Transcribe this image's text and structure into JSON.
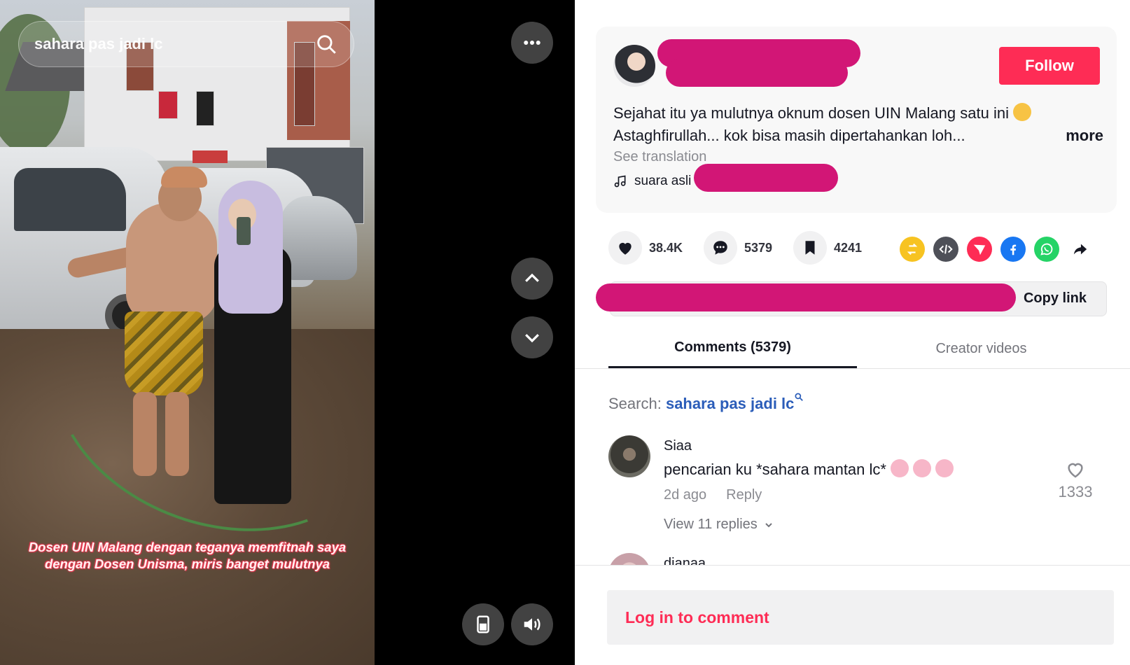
{
  "video": {
    "search_text": "sahara pas jadi lc",
    "caption_line1": "Dosen UIN Malang dengan teganya memfitnah saya",
    "caption_line2": "dengan Dosen Unisma, miris banget mulutnya"
  },
  "post": {
    "follow_label": "Follow",
    "desc_line1": "Sejahat itu ya mulutnya oknum dosen UIN Malang satu ini",
    "desc_line2": "Astaghfirullah... kok bisa masih dipertahankan loh...",
    "more_label": "more",
    "see_translation": "See translation",
    "music_label": "suara asli"
  },
  "actions": {
    "likes": "38.4K",
    "comments": "5379",
    "saves": "4241",
    "copy_link": "Copy link"
  },
  "tabs": {
    "comments": "Comments (5379)",
    "creator_videos": "Creator videos"
  },
  "search_hint": {
    "prefix": "Search:",
    "query": "sahara pas jadi lc"
  },
  "comments": [
    {
      "user": "Siaa",
      "text": "pencarian ku *sahara mantan lc*",
      "time": "2d ago",
      "reply": "Reply",
      "likes": "1333",
      "view_replies": "View 11 replies"
    },
    {
      "user": "dianaa"
    }
  ],
  "footer": {
    "login_prompt": "Log in to comment"
  },
  "colors": {
    "brand": "#fe2c55",
    "redaction": "#d21676",
    "link": "#2b5db9"
  }
}
